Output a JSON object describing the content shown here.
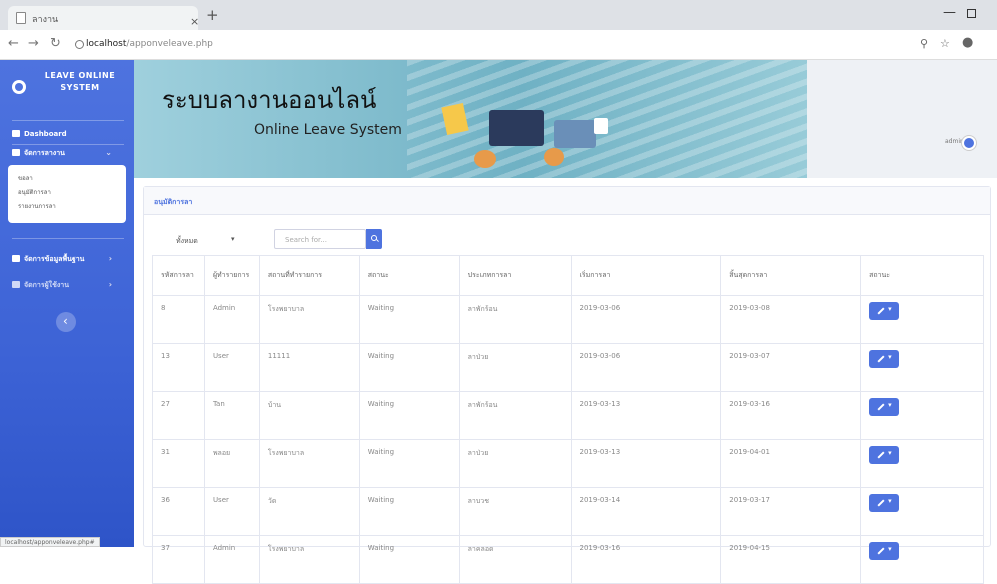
{
  "browser": {
    "tab_title": "ลางาน",
    "close": "×",
    "new_tab": "+",
    "address_host": "localhost",
    "address_path": "/apponveleave.php",
    "status_url": "localhost/apponveleave.php#"
  },
  "sidebar": {
    "brand": "LEAVE ONLINE SYSTEM",
    "dashboard": "Dashboard",
    "leave_menu": "จัดการลางาน",
    "submenu": [
      "ขอลา",
      "อนุมัติการลา",
      "รายงานการลา"
    ],
    "basic_data": "จัดการข้อมูลพื้นฐาน",
    "users": "จัดการผู้ใช้งาน",
    "chevron": "›",
    "chevron_open": "⌄"
  },
  "banner": {
    "title_th": "ระบบลางานออนไลน์",
    "title_en": "Online Leave System",
    "user": "admin"
  },
  "card": {
    "title": "อนุมัติการลา",
    "filter_value": "ทั้งหมด",
    "filter_caret": "▾",
    "search_placeholder": "Search for..."
  },
  "table": {
    "headers": [
      "รหัสการลา",
      "ผู้ทำรายการ",
      "สถานที่ทำรายการ",
      "สถานะ",
      "ประเภทการลา",
      "เริ่มการลา",
      "สิ้นสุดการลา",
      "สถานะ"
    ],
    "rows": [
      [
        "8",
        "Admin",
        "โรงพยาบาล",
        "Waiting",
        "ลาพักร้อน",
        "2019-03-06",
        "2019-03-08"
      ],
      [
        "13",
        "User",
        "11111",
        "Waiting",
        "ลาป่วย",
        "2019-03-06",
        "2019-03-07"
      ],
      [
        "27",
        "Tan",
        "บ้าน",
        "Waiting",
        "ลาพักร้อน",
        "2019-03-13",
        "2019-03-16"
      ],
      [
        "31",
        "พลอย",
        "โรงพยาบาล",
        "Waiting",
        "ลาป่วย",
        "2019-03-13",
        "2019-04-01"
      ],
      [
        "36",
        "User",
        "วัด",
        "Waiting",
        "ลาบวช",
        "2019-03-14",
        "2019-03-17"
      ],
      [
        "37",
        "Admin",
        "โรงพยาบาล",
        "Waiting",
        "ลาคลอด",
        "2019-03-16",
        "2019-04-15"
      ]
    ]
  },
  "colors": {
    "primary": "#4e73df",
    "sidebar_dark": "#2e54c8"
  }
}
